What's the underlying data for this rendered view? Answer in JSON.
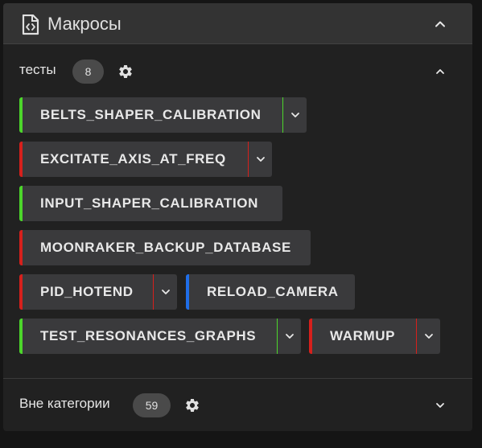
{
  "panel": {
    "title": "Макросы",
    "icon": "file-code-icon"
  },
  "groups": [
    {
      "name": "тесты",
      "count": "8",
      "expanded": true,
      "macros": [
        {
          "label": "BELTS_SHAPER_CALIBRATION",
          "status_color": "#4cd62b",
          "has_dropdown": true
        },
        {
          "label": "EXCITATE_AXIS_AT_FREQ",
          "status_color": "#d6201c",
          "has_dropdown": true
        },
        {
          "label": "INPUT_SHAPER_CALIBRATION",
          "status_color": "#4cd62b",
          "has_dropdown": false
        },
        {
          "label": "MOONRAKER_BACKUP_DATABASE",
          "status_color": "#d6201c",
          "has_dropdown": false
        },
        {
          "label": "PID_HOTEND",
          "status_color": "#d6201c",
          "has_dropdown": true
        },
        {
          "label": "RELOAD_CAMERA",
          "status_color": "#1f6ee8",
          "has_dropdown": false
        },
        {
          "label": "TEST_RESONANCES_GRAPHS",
          "status_color": "#4cd62b",
          "has_dropdown": true
        },
        {
          "label": "WARMUP",
          "status_color": "#d6201c",
          "has_dropdown": true
        }
      ]
    },
    {
      "name": "Вне категории",
      "count": "59",
      "expanded": false,
      "macros": []
    }
  ],
  "colors": {
    "background": "#151515",
    "panel": "#212121",
    "header": "#333333",
    "button": "#3a3a3c",
    "ready": "#4cd62b",
    "error": "#d6201c",
    "info": "#1f6ee8"
  }
}
